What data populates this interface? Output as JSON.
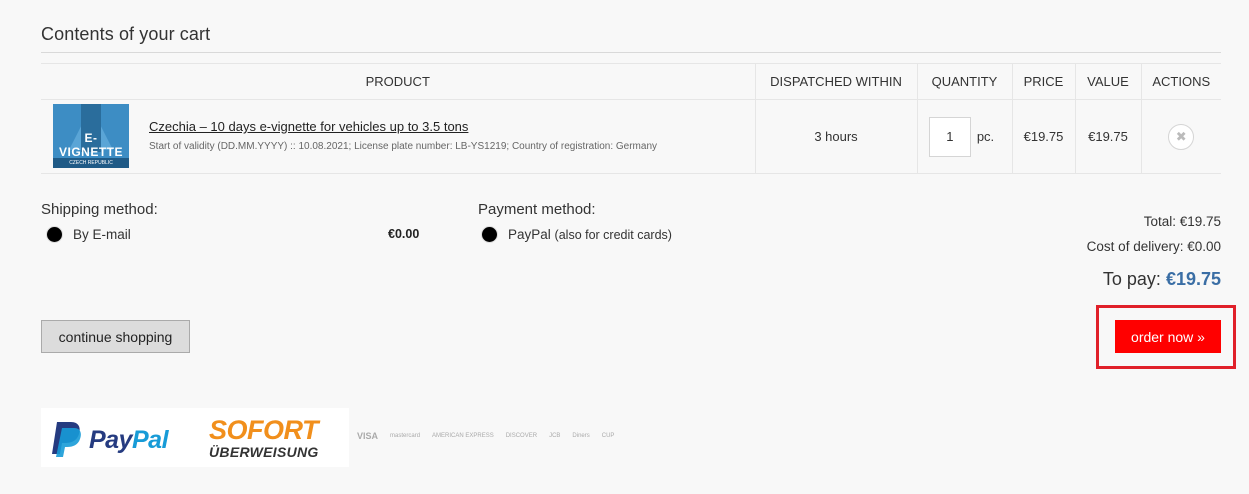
{
  "cart": {
    "title": "Contents of your cart",
    "columns": [
      "PRODUCT",
      "DISPATCHED WITHIN",
      "QUANTITY",
      "PRICE",
      "VALUE",
      "ACTIONS"
    ],
    "items": [
      {
        "thumb_text": "E-VIGNETTE",
        "thumb_strip": "CZECH REPUBLIC",
        "name": "Czechia – 10 days e-vignette for vehicles up to 3.5 tons",
        "meta": "Start of validity (DD.MM.YYYY) :: 10.08.2021; License plate number: LB-YS1219; Country of registration: Germany",
        "dispatched": "3 hours",
        "quantity": "1",
        "unit": "pc.",
        "price": "€19.75",
        "value": "€19.75",
        "remove_icon": "close-icon"
      }
    ]
  },
  "shipping": {
    "label": "Shipping method:",
    "option": "By E-mail",
    "price": "€0.00"
  },
  "payment": {
    "label": "Payment method:",
    "option": "PayPal",
    "option_sub": "(also for credit cards)"
  },
  "totals": {
    "total": "Total: €19.75",
    "delivery": "Cost of delivery: €0.00",
    "to_pay_label": "To pay:",
    "to_pay_amount": "€19.75"
  },
  "actions": {
    "continue": "continue shopping",
    "order": "order now »"
  },
  "logos": {
    "paypal_pay": "Pay",
    "paypal_pal": "Pal",
    "sofort_1": "SOFORT",
    "sofort_2": "ÜBERWEISUNG",
    "cards": [
      "VISA",
      "mastercard",
      "AMERICAN EXPRESS",
      "DISCOVER",
      "JCB",
      "Diners",
      "CUP"
    ]
  },
  "colors": {
    "order_button": "#ff0000",
    "highlight_frame": "#e0202a",
    "to_pay_amount": "#3a6ea5"
  }
}
